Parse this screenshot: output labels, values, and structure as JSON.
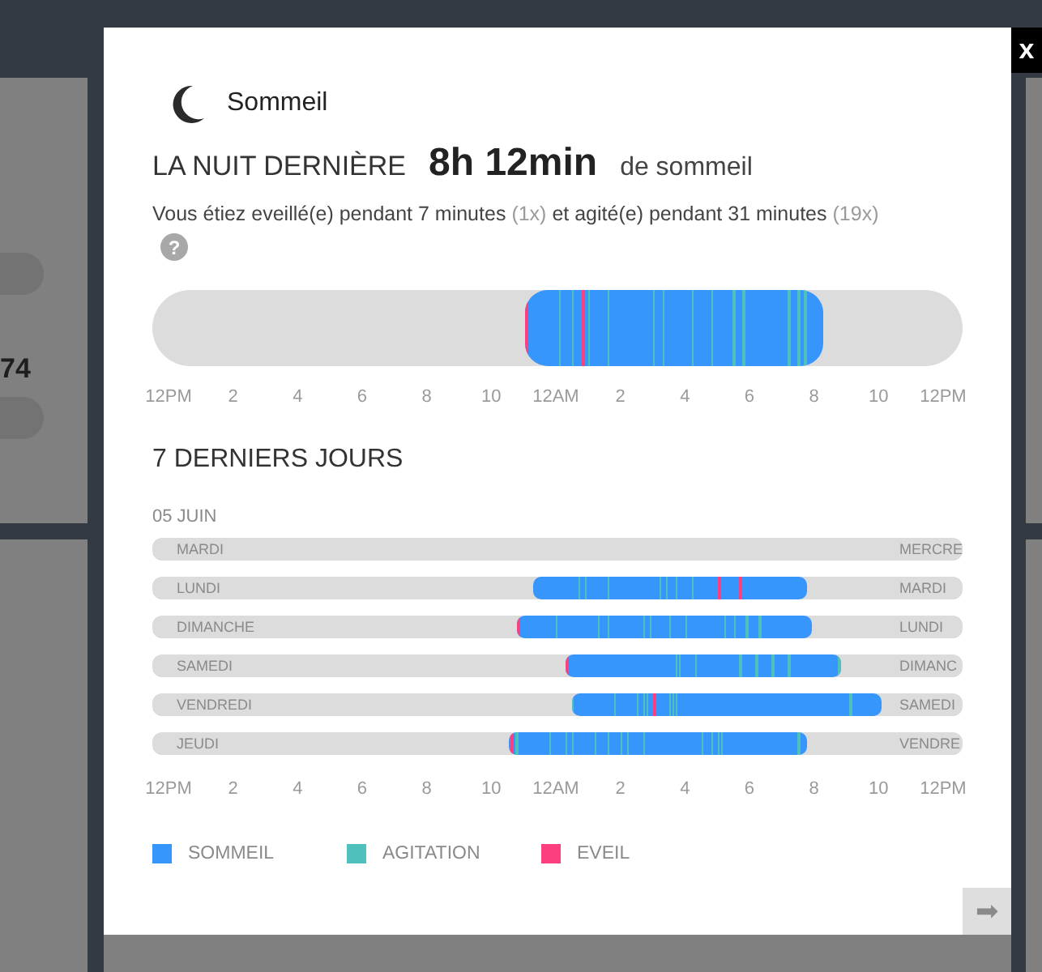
{
  "background": {
    "value": "74"
  },
  "dialog": {
    "close": "x",
    "title": "Sommeil",
    "headline": {
      "label": "LA NUIT DERNIÈRE",
      "duration": "8h 12min",
      "suffix": "de sommeil"
    },
    "summary": [
      {
        "text": "Vous étiez eveillé(e) pendant 7 minutes",
        "muted": false
      },
      {
        "text": "(1x)",
        "muted": true
      },
      {
        "text": "et agité(e) pendant 31 minutes",
        "muted": false
      },
      {
        "text": "(19x)",
        "muted": true
      }
    ],
    "help": "?",
    "last_night": {
      "axis_labels": [
        "12PM",
        "2",
        "4",
        "6",
        "8",
        "10",
        "12AM",
        "2",
        "4",
        "6",
        "8",
        "10",
        "12PM"
      ]
    },
    "week": {
      "title": "7 DERNIERS JOURS",
      "date": "05 JUIN",
      "days": [
        {
          "label": "MARDI",
          "next_label": "MERCRE"
        },
        {
          "label": "LUNDI",
          "next_label": "MARDI"
        },
        {
          "label": "DIMANCHE",
          "next_label": "LUNDI"
        },
        {
          "label": "SAMEDI",
          "next_label": "DIMANC"
        },
        {
          "label": "VENDREDI",
          "next_label": "SAMEDI"
        },
        {
          "label": "JEUDI",
          "next_label": "VENDRE"
        }
      ],
      "axis_labels": [
        "12PM",
        "2",
        "4",
        "6",
        "8",
        "10",
        "12AM",
        "2",
        "4",
        "6",
        "8",
        "10",
        "12PM"
      ]
    },
    "legend": [
      {
        "label": "SOMMEIL",
        "color": "#3796fc"
      },
      {
        "label": "AGITATION",
        "color": "#4fc1bd"
      },
      {
        "label": "EVEIL",
        "color": "#fc3f7f"
      }
    ],
    "next": "➡"
  }
}
